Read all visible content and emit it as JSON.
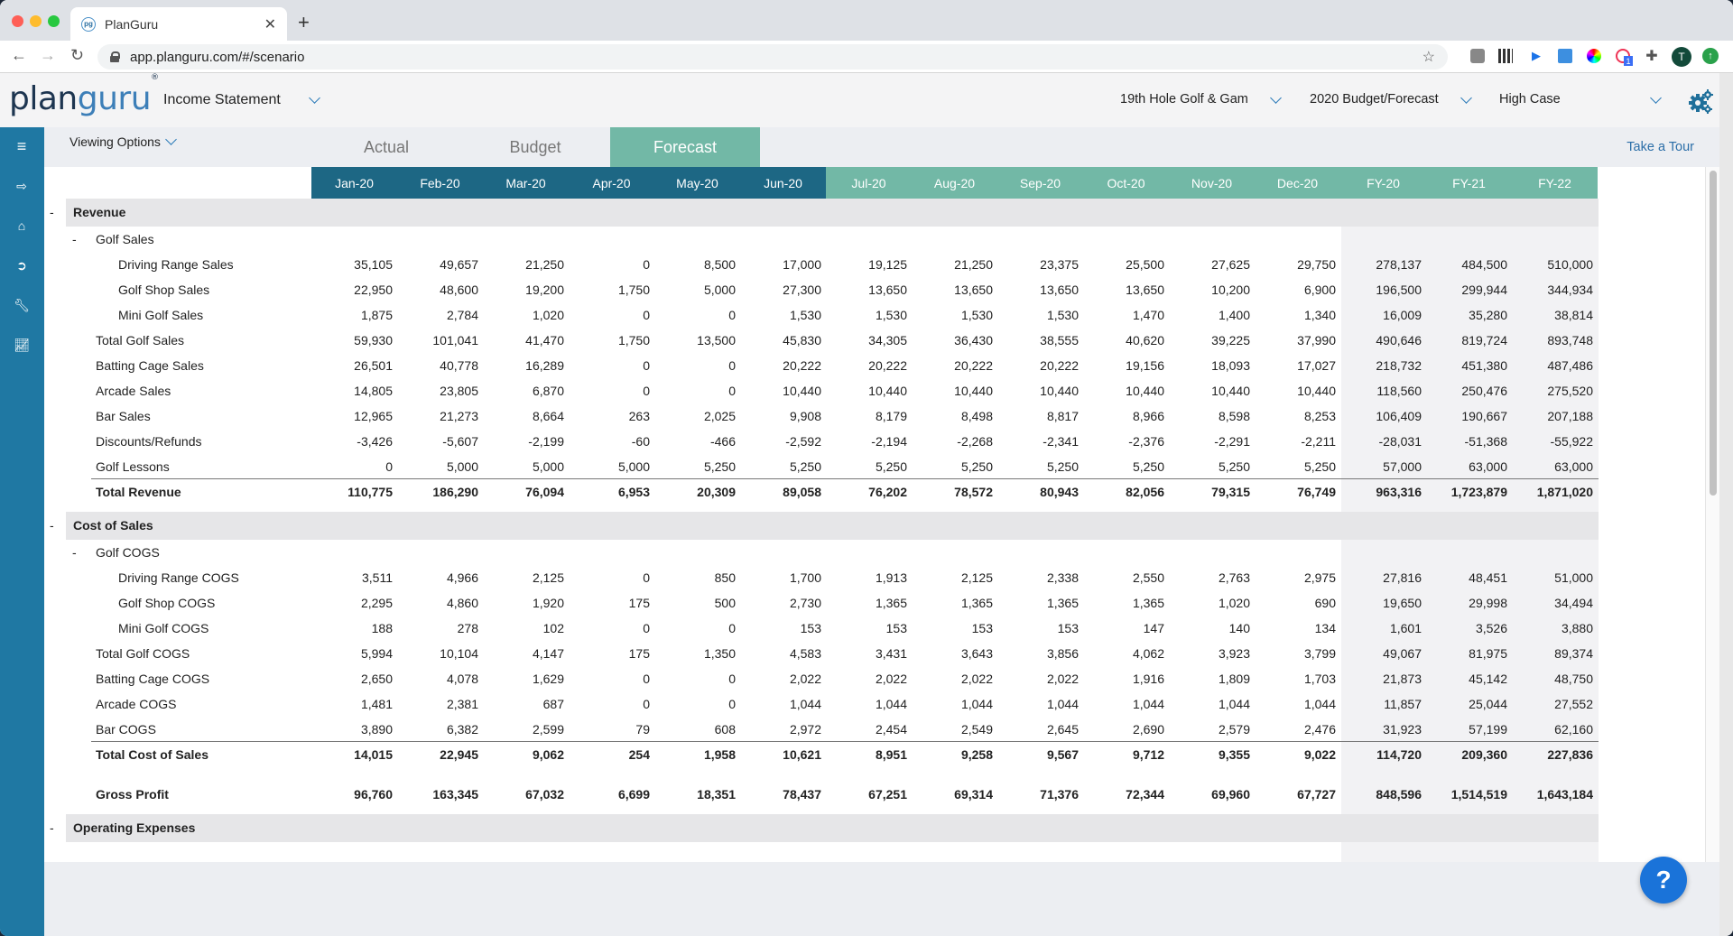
{
  "browser": {
    "tab_title": "PlanGuru",
    "favicon_text": "pg",
    "url": "app.planguru.com/#/scenario",
    "avatar_initial": "T",
    "lastpass_badge": "1"
  },
  "header": {
    "logo_plan": "plan",
    "logo_guru": "guru",
    "logo_mark": "®",
    "report": "Income Statement",
    "company": "19th Hole Golf & Gam",
    "plan": "2020 Budget/Forecast",
    "scenario": "High Case"
  },
  "options": {
    "viewing_options": "Viewing Options",
    "take_tour": "Take a Tour",
    "tabs": [
      {
        "label": "Actual",
        "active": false
      },
      {
        "label": "Budget",
        "active": false
      },
      {
        "label": "Forecast",
        "active": true
      }
    ]
  },
  "sidebar": {
    "items": [
      "menu-icon",
      "logout-icon",
      "home-icon",
      "arrow-circle-icon",
      "wrench-icon",
      "chart-line-icon"
    ]
  },
  "columns": [
    {
      "label": "Jan-20",
      "kind": "actual"
    },
    {
      "label": "Feb-20",
      "kind": "actual"
    },
    {
      "label": "Mar-20",
      "kind": "actual"
    },
    {
      "label": "Apr-20",
      "kind": "actual"
    },
    {
      "label": "May-20",
      "kind": "actual"
    },
    {
      "label": "Jun-20",
      "kind": "actual"
    },
    {
      "label": "Jul-20",
      "kind": "forecast"
    },
    {
      "label": "Aug-20",
      "kind": "forecast"
    },
    {
      "label": "Sep-20",
      "kind": "forecast"
    },
    {
      "label": "Oct-20",
      "kind": "forecast"
    },
    {
      "label": "Nov-20",
      "kind": "forecast"
    },
    {
      "label": "Dec-20",
      "kind": "forecast"
    },
    {
      "label": "FY-20",
      "kind": "forecast"
    },
    {
      "label": "FY-21",
      "kind": "forecast"
    },
    {
      "label": "FY-22",
      "kind": "forecast"
    }
  ],
  "rows": [
    {
      "type": "section",
      "label": "Revenue",
      "toggle": "-"
    },
    {
      "type": "group",
      "label": "Golf Sales",
      "toggle": "-"
    },
    {
      "type": "item",
      "level": 2,
      "label": "Driving Range Sales",
      "values": [
        "35,105",
        "49,657",
        "21,250",
        "0",
        "8,500",
        "17,000",
        "19,125",
        "21,250",
        "23,375",
        "25,500",
        "27,625",
        "29,750",
        "278,137",
        "484,500",
        "510,000"
      ]
    },
    {
      "type": "item",
      "level": 2,
      "label": "Golf Shop Sales",
      "values": [
        "22,950",
        "48,600",
        "19,200",
        "1,750",
        "5,000",
        "27,300",
        "13,650",
        "13,650",
        "13,650",
        "13,650",
        "10,200",
        "6,900",
        "196,500",
        "299,944",
        "344,934"
      ]
    },
    {
      "type": "item",
      "level": 2,
      "label": "Mini Golf Sales",
      "values": [
        "1,875",
        "2,784",
        "1,020",
        "0",
        "0",
        "1,530",
        "1,530",
        "1,530",
        "1,530",
        "1,470",
        "1,400",
        "1,340",
        "16,009",
        "35,280",
        "38,814"
      ]
    },
    {
      "type": "item",
      "level": 1,
      "label": "Total Golf Sales",
      "values": [
        "59,930",
        "101,041",
        "41,470",
        "1,750",
        "13,500",
        "45,830",
        "34,305",
        "36,430",
        "38,555",
        "40,620",
        "39,225",
        "37,990",
        "490,646",
        "819,724",
        "893,748"
      ]
    },
    {
      "type": "item",
      "level": 1,
      "label": "Batting Cage Sales",
      "values": [
        "26,501",
        "40,778",
        "16,289",
        "0",
        "0",
        "20,222",
        "20,222",
        "20,222",
        "20,222",
        "19,156",
        "18,093",
        "17,027",
        "218,732",
        "451,380",
        "487,486"
      ]
    },
    {
      "type": "item",
      "level": 1,
      "label": "Arcade Sales",
      "values": [
        "14,805",
        "23,805",
        "6,870",
        "0",
        "0",
        "10,440",
        "10,440",
        "10,440",
        "10,440",
        "10,440",
        "10,440",
        "10,440",
        "118,560",
        "250,476",
        "275,520"
      ]
    },
    {
      "type": "item",
      "level": 1,
      "label": "Bar Sales",
      "values": [
        "12,965",
        "21,273",
        "8,664",
        "263",
        "2,025",
        "9,908",
        "8,179",
        "8,498",
        "8,817",
        "8,966",
        "8,598",
        "8,253",
        "106,409",
        "190,667",
        "207,188"
      ]
    },
    {
      "type": "item",
      "level": 1,
      "label": "Discounts/Refunds",
      "values": [
        "-3,426",
        "-5,607",
        "-2,199",
        "-60",
        "-466",
        "-2,592",
        "-2,194",
        "-2,268",
        "-2,341",
        "-2,376",
        "-2,291",
        "-2,211",
        "-28,031",
        "-51,368",
        "-55,922"
      ]
    },
    {
      "type": "item",
      "level": 1,
      "label": "Golf Lessons",
      "values": [
        "0",
        "5,000",
        "5,000",
        "5,000",
        "5,250",
        "5,250",
        "5,250",
        "5,250",
        "5,250",
        "5,250",
        "5,250",
        "5,250",
        "57,000",
        "63,000",
        "63,000"
      ]
    },
    {
      "type": "total",
      "level": 1,
      "label": "Total Revenue",
      "values": [
        "110,775",
        "186,290",
        "76,094",
        "6,953",
        "20,309",
        "89,058",
        "76,202",
        "78,572",
        "80,943",
        "82,056",
        "79,315",
        "76,749",
        "963,316",
        "1,723,879",
        "1,871,020"
      ]
    },
    {
      "type": "section",
      "label": "Cost of Sales",
      "toggle": "-"
    },
    {
      "type": "group",
      "label": "Golf COGS",
      "toggle": "-"
    },
    {
      "type": "item",
      "level": 2,
      "label": "Driving Range COGS",
      "values": [
        "3,511",
        "4,966",
        "2,125",
        "0",
        "850",
        "1,700",
        "1,913",
        "2,125",
        "2,338",
        "2,550",
        "2,763",
        "2,975",
        "27,816",
        "48,451",
        "51,000"
      ]
    },
    {
      "type": "item",
      "level": 2,
      "label": "Golf Shop COGS",
      "values": [
        "2,295",
        "4,860",
        "1,920",
        "175",
        "500",
        "2,730",
        "1,365",
        "1,365",
        "1,365",
        "1,365",
        "1,020",
        "690",
        "19,650",
        "29,998",
        "34,494"
      ]
    },
    {
      "type": "item",
      "level": 2,
      "label": "Mini Golf COGS",
      "values": [
        "188",
        "278",
        "102",
        "0",
        "0",
        "153",
        "153",
        "153",
        "153",
        "147",
        "140",
        "134",
        "1,601",
        "3,526",
        "3,880"
      ]
    },
    {
      "type": "item",
      "level": 1,
      "label": "Total Golf COGS",
      "values": [
        "5,994",
        "10,104",
        "4,147",
        "175",
        "1,350",
        "4,583",
        "3,431",
        "3,643",
        "3,856",
        "4,062",
        "3,923",
        "3,799",
        "49,067",
        "81,975",
        "89,374"
      ]
    },
    {
      "type": "item",
      "level": 1,
      "label": "Batting Cage COGS",
      "values": [
        "2,650",
        "4,078",
        "1,629",
        "0",
        "0",
        "2,022",
        "2,022",
        "2,022",
        "2,022",
        "1,916",
        "1,809",
        "1,703",
        "21,873",
        "45,142",
        "48,750"
      ]
    },
    {
      "type": "item",
      "level": 1,
      "label": "Arcade COGS",
      "values": [
        "1,481",
        "2,381",
        "687",
        "0",
        "0",
        "1,044",
        "1,044",
        "1,044",
        "1,044",
        "1,044",
        "1,044",
        "1,044",
        "11,857",
        "25,044",
        "27,552"
      ]
    },
    {
      "type": "item",
      "level": 1,
      "label": "Bar COGS",
      "values": [
        "3,890",
        "6,382",
        "2,599",
        "79",
        "608",
        "2,972",
        "2,454",
        "2,549",
        "2,645",
        "2,690",
        "2,579",
        "2,476",
        "31,923",
        "57,199",
        "62,160"
      ]
    },
    {
      "type": "total",
      "level": 1,
      "label": "Total Cost of Sales",
      "values": [
        "14,015",
        "22,945",
        "9,062",
        "254",
        "1,958",
        "10,621",
        "8,951",
        "9,258",
        "9,567",
        "9,712",
        "9,355",
        "9,022",
        "114,720",
        "209,360",
        "227,836"
      ]
    },
    {
      "type": "grand",
      "level": 1,
      "label": "Gross Profit",
      "values": [
        "96,760",
        "163,345",
        "67,032",
        "6,699",
        "18,351",
        "78,437",
        "67,251",
        "69,314",
        "71,376",
        "72,344",
        "69,960",
        "67,727",
        "848,596",
        "1,514,519",
        "1,643,184"
      ]
    },
    {
      "type": "section",
      "label": "Operating Expenses",
      "toggle": "-"
    }
  ],
  "help_label": "?",
  "colors": {
    "sidebar": "#1f78a3",
    "actual_header": "#1d6784",
    "forecast_header": "#72b8a6",
    "link": "#2b6ea8",
    "help_button": "#1a73d9"
  }
}
